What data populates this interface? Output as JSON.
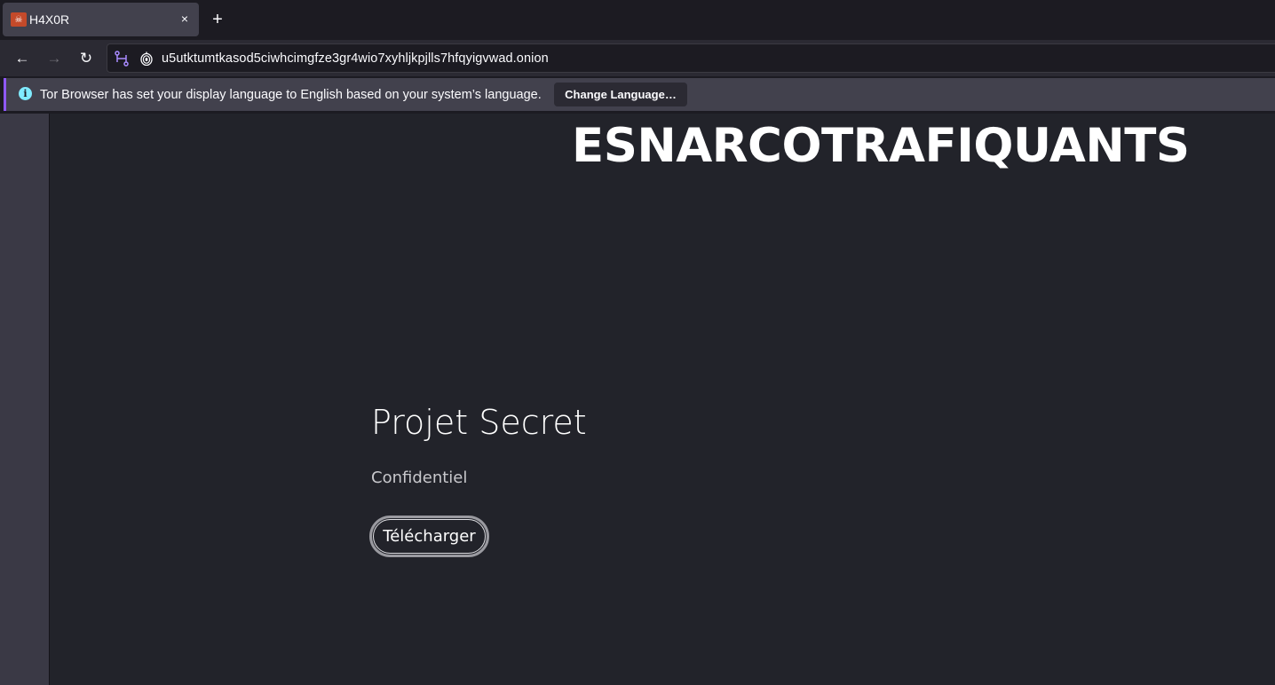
{
  "browser": {
    "tab": {
      "title": "H4X0R",
      "favicon": "skull-favicon",
      "close_glyph": "×"
    },
    "new_tab_glyph": "+",
    "nav": {
      "back_glyph": "←",
      "forward_glyph": "→",
      "reload_glyph": "↻"
    },
    "url": "u5utktumtkasod5ciwhcimgfze3gr4wio7xyhljkpjlls7hfqyigvwad.onion"
  },
  "notification": {
    "icon": "i",
    "message": "Tor Browser has set your display language to English based on your system’s language.",
    "button_label": "Change Language…"
  },
  "page": {
    "heading": "ESNARCOTRAFIQUANTS",
    "project": {
      "title": "Projet Secret",
      "subtitle": "Confidentiel",
      "button_label": "Télécharger"
    }
  },
  "colors": {
    "accent": "#9059ff",
    "info": "#80ebff",
    "page_bg": "#22232a"
  }
}
